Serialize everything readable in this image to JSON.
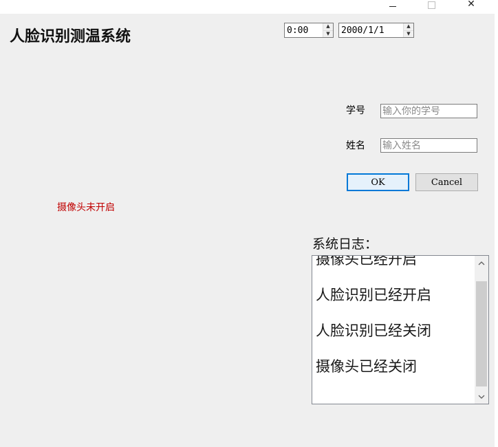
{
  "window": {
    "controls": {
      "minimize_icon": "minimize-icon",
      "maximize_icon": "maximize-icon",
      "close_icon": "close-icon",
      "close_glyph": "✕"
    }
  },
  "header": {
    "title": "人脸识别测温系统"
  },
  "time_picker": {
    "value": "0:00"
  },
  "date_picker": {
    "value": "2000/1/1"
  },
  "form": {
    "student_id_label": "学号",
    "student_id_placeholder": "输入你的学号",
    "student_id_value": "",
    "name_label": "姓名",
    "name_placeholder": "输入姓名",
    "name_value": "",
    "ok_label": "OK",
    "cancel_label": "Cancel"
  },
  "camera": {
    "status_text": "摄像头未开启",
    "status_color": "#c00000"
  },
  "log": {
    "label": "系统日志：",
    "lines": [
      "摄像头已经开启",
      "人脸识别已经开启",
      "人脸识别已经关闭",
      "摄像头已经关闭"
    ]
  },
  "colors": {
    "background": "#efefef",
    "accent": "#0078d7"
  }
}
